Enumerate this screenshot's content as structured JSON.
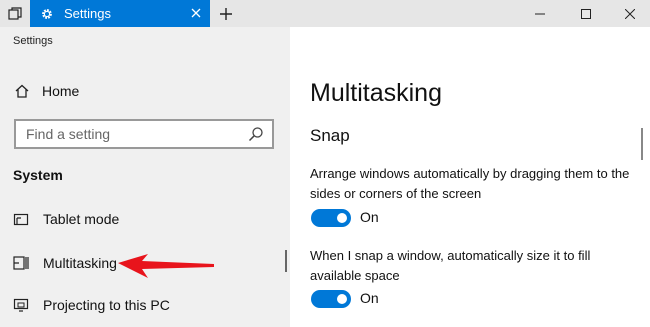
{
  "window": {
    "tab_title": "Settings",
    "accent": "#0078d7"
  },
  "sidebar": {
    "caption": "Settings",
    "home_label": "Home",
    "search_placeholder": "Find a setting",
    "section_title": "System",
    "items": [
      {
        "label": "Tablet mode",
        "icon": "tablet-mode-icon"
      },
      {
        "label": "Multitasking",
        "icon": "multitasking-icon"
      },
      {
        "label": "Projecting to this PC",
        "icon": "projecting-icon"
      }
    ]
  },
  "main": {
    "title": "Multitasking",
    "section": "Snap",
    "settings": [
      {
        "description": "Arrange windows automatically by dragging them to the sides or corners of the screen",
        "state": "On"
      },
      {
        "description": "When I snap a window, automatically size it to fill available space",
        "state": "On"
      }
    ]
  },
  "annotation": {
    "color": "#e8141c"
  }
}
